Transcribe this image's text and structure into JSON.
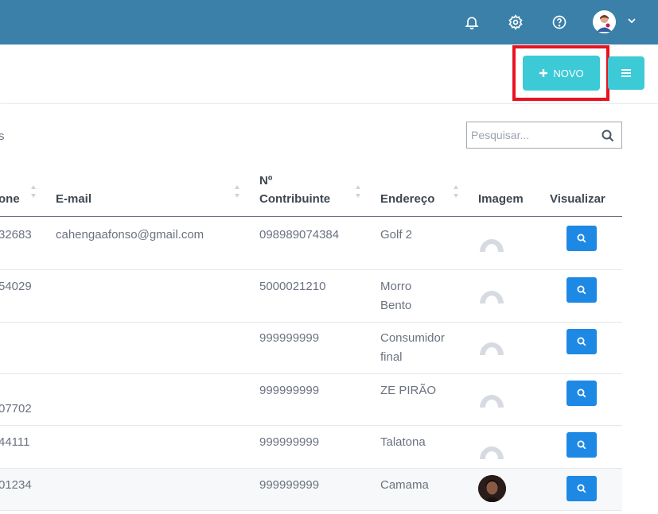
{
  "topbar": {
    "icons": [
      "bell-icon",
      "gear-icon",
      "help-icon",
      "avatar",
      "chevron-down-icon"
    ]
  },
  "actions": {
    "new_label": "NOVO"
  },
  "list": {
    "fragment_text": "s"
  },
  "search": {
    "placeholder": "Pesquisar..."
  },
  "table": {
    "columns": {
      "phone": "one",
      "email": "E-mail",
      "nif_line1": "Nº",
      "nif_line2": "Contribuinte",
      "address": "Endereço",
      "image": "Imagem",
      "view": "Visualizar"
    },
    "rows": [
      {
        "phone": "32683",
        "email": "cahengaafonso@gmail.com",
        "nif": "098989074384",
        "address_line1": "Golf 2",
        "address_line2": "",
        "image": "placeholder"
      },
      {
        "phone": "54029",
        "email": "",
        "nif": "5000021210",
        "address_line1": "Morro",
        "address_line2": "Bento",
        "image": "placeholder"
      },
      {
        "phone": "",
        "email": "",
        "nif": "999999999",
        "address_line1": "Consumidor",
        "address_line2": "final",
        "image": "placeholder"
      },
      {
        "phone": "07702",
        "email": "",
        "nif": "999999999",
        "address_line1": "ZE PIRÃO",
        "address_line2": "",
        "image": "placeholder"
      },
      {
        "phone": "44111",
        "email": "",
        "nif": "999999999",
        "address_line1": "Talatona",
        "address_line2": "",
        "image": "placeholder"
      },
      {
        "phone": "01234",
        "email": "",
        "nif": "999999999",
        "address_line1": "Camama",
        "address_line2": "",
        "image": "photo"
      }
    ]
  },
  "colors": {
    "topbar": "#3a80a9",
    "accent": "#3ccad6",
    "view_button": "#1e88e5",
    "highlight": "#e8131f"
  }
}
